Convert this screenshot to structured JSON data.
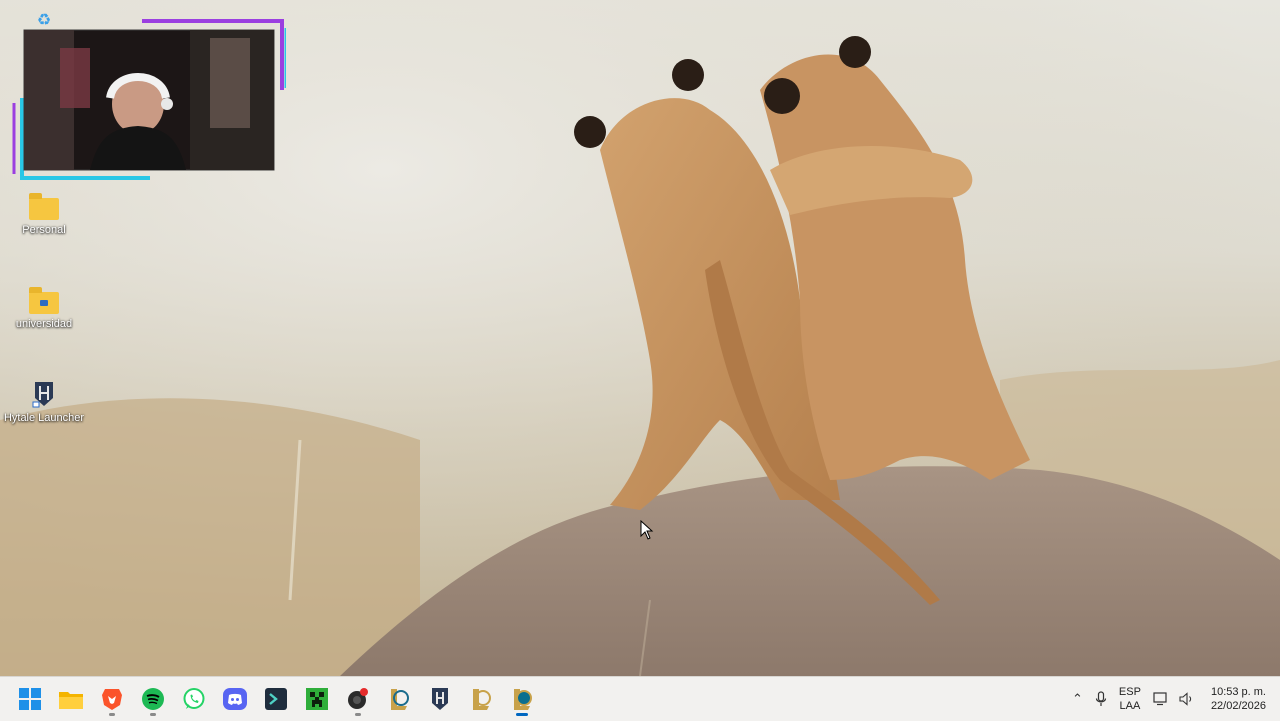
{
  "desktop": {
    "icons": [
      {
        "label": "Personal",
        "icon": "folder-icon"
      },
      {
        "label": "universidad",
        "icon": "folder-icon"
      },
      {
        "label": "Hytale Launcher",
        "icon": "hytale-launcher-icon"
      }
    ]
  },
  "taskbar": {
    "apps": [
      {
        "name": "start-menu",
        "icon": "windows-logo-icon"
      },
      {
        "name": "file-explorer",
        "icon": "folder-icon"
      },
      {
        "name": "brave-browser",
        "icon": "brave-lion-icon"
      },
      {
        "name": "spotify",
        "icon": "spotify-icon"
      },
      {
        "name": "whatsapp",
        "icon": "whatsapp-icon"
      },
      {
        "name": "discord",
        "icon": "discord-icon"
      },
      {
        "name": "terminal-app",
        "icon": "terminal-icon"
      },
      {
        "name": "minecraft",
        "icon": "creeper-icon"
      },
      {
        "name": "recording-app",
        "icon": "record-icon"
      },
      {
        "name": "league-client",
        "icon": "league-icon"
      },
      {
        "name": "hytale-launcher",
        "icon": "hytale-launcher-icon"
      },
      {
        "name": "league-of-legends",
        "icon": "league-icon"
      },
      {
        "name": "league-of-legends-game",
        "icon": "league-game-icon"
      }
    ],
    "tray": {
      "language_line1": "ESP",
      "language_line2": "LAA",
      "time": "10:53 p. m.",
      "date": "22/02/2026"
    }
  },
  "colors": {
    "accent": "#0067c0",
    "taskbar_bg": "#f2f1ef",
    "webcam_border_purple": "#9b3fe0",
    "webcam_border_cyan": "#29c7e6"
  }
}
